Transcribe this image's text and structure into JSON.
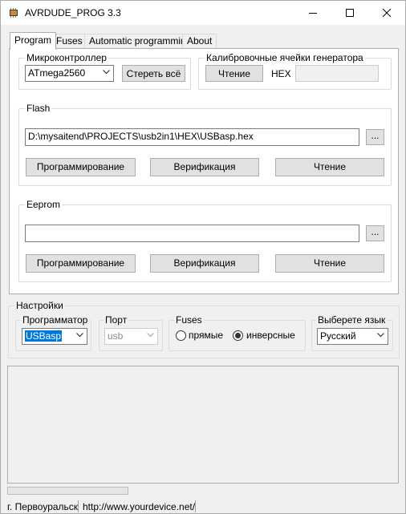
{
  "window": {
    "title": "AVRDUDE_PROG 3.3"
  },
  "tabs": [
    {
      "label": "Program",
      "active": true
    },
    {
      "label": "Fuses",
      "active": false
    },
    {
      "label": "Automatic programming",
      "active": false
    },
    {
      "label": "About",
      "active": false
    }
  ],
  "mcu": {
    "legend": "Микроконтроллер",
    "selected": "ATmega2560",
    "erase_label": "Стереть всё"
  },
  "calib": {
    "legend": "Калибровочные ячейки генератора",
    "read_label": "Чтение",
    "hex_label": "HEX",
    "hex_value": ""
  },
  "flash": {
    "legend": "Flash",
    "file_path": "D:\\mysaitend\\PROJECTS\\usb2in1\\HEX\\USBasp.hex",
    "browse_label": "...",
    "program_label": "Программирование",
    "verify_label": "Верификация",
    "read_label": "Чтение"
  },
  "eeprom": {
    "legend": "Eeprom",
    "file_path": "",
    "browse_label": "...",
    "program_label": "Программирование",
    "verify_label": "Верификация",
    "read_label": "Чтение"
  },
  "settings": {
    "legend": "Настройки",
    "programmer": {
      "legend": "Программатор",
      "selected": "USBasp"
    },
    "port": {
      "legend": "Порт",
      "selected": "usb"
    },
    "fuses": {
      "legend": "Fuses",
      "option_direct": "прямые",
      "option_inverse": "инверсные",
      "selected": "инверсные"
    },
    "language": {
      "legend": "Выберете язык",
      "selected": "Русский"
    }
  },
  "output_log": "",
  "progress": 0,
  "status": {
    "city": "г. Первоуральск",
    "url": "http://www.yourdevice.net/"
  }
}
